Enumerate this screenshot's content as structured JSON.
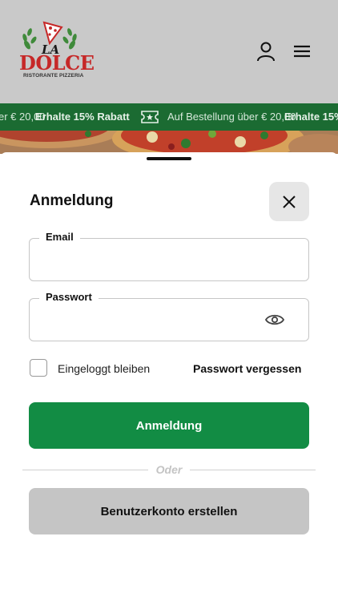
{
  "brand": {
    "logo_small": "LA",
    "logo_main": "DOLCE",
    "logo_sub": "RISTORANTE PIZZERIA",
    "red": "#c62828",
    "green": "#1b6b32"
  },
  "header": {
    "icons": [
      "user-icon",
      "hamburger-menu-icon"
    ]
  },
  "marquee": {
    "items": [
      "er € 20,00",
      "Erhalte 15% Rabatt",
      "Auf Bestellung über € 20,00",
      "Erhalte 15%"
    ]
  },
  "login": {
    "title": "Anmeldung",
    "email_label": "Email",
    "email_value": "",
    "password_label": "Passwort",
    "password_value": "",
    "remember_label": "Eingeloggt bleiben",
    "remember_checked": false,
    "forgot_label": "Passwort vergessen",
    "submit_label": "Anmeldung",
    "divider_label": "Oder",
    "signup_label": "Benutzerkonto erstellen",
    "accent": "#128c44"
  }
}
